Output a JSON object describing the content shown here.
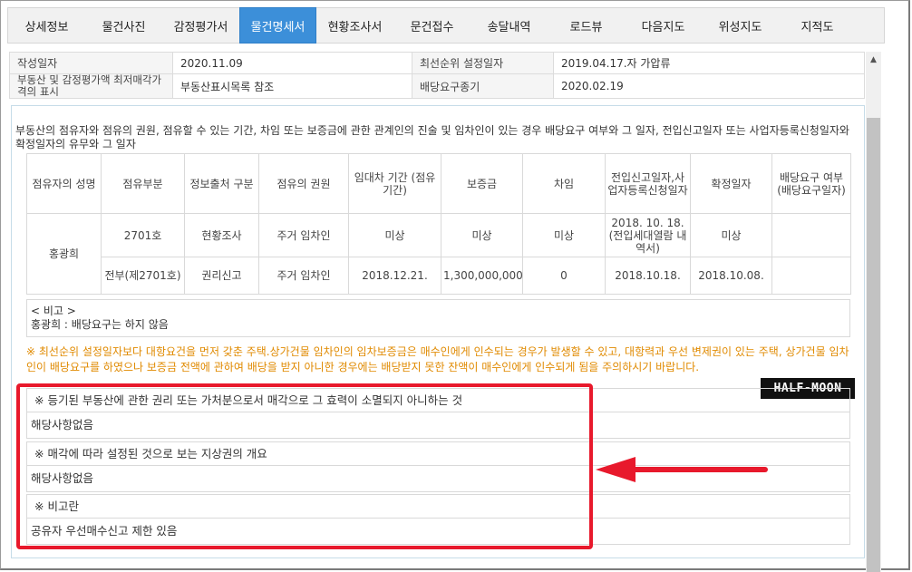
{
  "tabs": [
    {
      "label": "상세정보",
      "active": false
    },
    {
      "label": "물건사진",
      "active": false
    },
    {
      "label": "감정평가서",
      "active": false
    },
    {
      "label": "물건명세서",
      "active": true
    },
    {
      "label": "현황조사서",
      "active": false
    },
    {
      "label": "문건접수",
      "active": false
    },
    {
      "label": "송달내역",
      "active": false
    },
    {
      "label": "로드뷰",
      "active": false
    },
    {
      "label": "다음지도",
      "active": false
    },
    {
      "label": "위성지도",
      "active": false
    },
    {
      "label": "지적도",
      "active": false
    }
  ],
  "info": {
    "created_label": "작성일자",
    "created_value": "2020.11.09",
    "priority_label": "최선순위 설정일자",
    "priority_value": "2019.04.17.자 가압류",
    "min_price_label": "부동산 및 감정평가액 최저매각가격의 표시",
    "min_price_value": "부동산표시목록 참조",
    "deadline_label": "배당요구종기",
    "deadline_value": "2020.02.19"
  },
  "description": "부동산의 점유자와 점유의 권원, 점유할 수 있는 기간, 차임 또는 보증금에 관한 관계인의 진술 및 임차인이 있는 경우 배당요구 여부와 그 일자, 전입신고일자 또는 사업자등록신청일자와 확정일자의 유무와 그 일자",
  "occupancy": {
    "headers": [
      "점유자의 성명",
      "점유부분",
      "정보출처 구분",
      "점유의 권원",
      "임대차 기간 (점유기간)",
      "보증금",
      "차임",
      "전입신고일자,사업자등록신청일자",
      "확정일자",
      "배당요구 여부 (배당요구일자)"
    ],
    "occupant": "홍광희",
    "rows": [
      [
        "2701호",
        "현황조사",
        "주거 임차인",
        "미상",
        "미상",
        "미상",
        "2018. 10. 18. (전입세대열람 내역서)",
        "미상",
        ""
      ],
      [
        "전부(제2701호)",
        "권리신고",
        "주거 임차인",
        "2018.12.21.",
        "1,300,000,000",
        "0",
        "2018.10.18.",
        "2018.10.08.",
        ""
      ]
    ]
  },
  "note": {
    "title": "< 비고 >",
    "text": "홍광희 : 배당요구는 하지 않음"
  },
  "warning": "※ 최선순위 설정일자보다 대항요건을 먼저 갖춘 주택.상가건물 임차인의 임차보증금은 매수인에게 인수되는 경우가 발생할 수 있고, 대항력과 우선 변제권이 있는 주택, 상가건물 임차인이 배당요구를 하였으나 보증금 전액에 관하여 배당을 받지 아니한 경우에는 배당받지 못한 잔액이 매수인에게 인수되게 됨을 주의하시기 바랍니다.",
  "sections": [
    {
      "title": "※ 등기된 부동산에 관한 권리 또는 가처분으로서 매각으로 그 효력이 소멸되지 아니하는 것",
      "body": "해당사항없음"
    },
    {
      "title": "※ 매각에 따라 설정된 것으로 보는 지상권의 개요",
      "body": "해당사항없음"
    },
    {
      "title": "※ 비고란",
      "body": "공유자 우선매수신고 제한 있음"
    }
  ],
  "watermark": "HALF-MOON",
  "colors": {
    "active_tab": "#3c8fd9",
    "highlight": "#e8192c",
    "warning": "#e08a00"
  }
}
